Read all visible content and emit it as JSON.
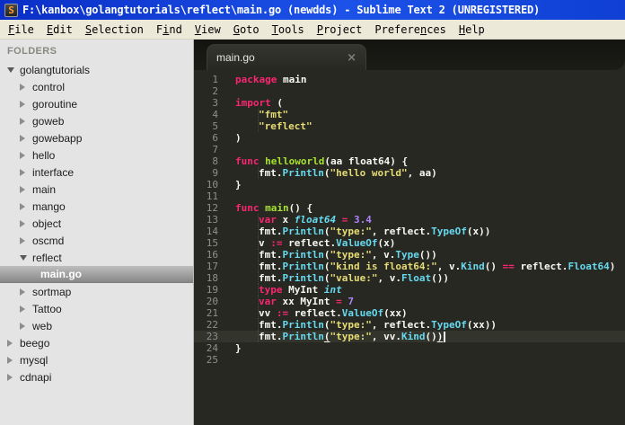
{
  "window": {
    "title": "F:\\kanbox\\golangtutorials\\reflect\\main.go (newdds) - Sublime Text 2 (UNREGISTERED)",
    "logo_letter": "S"
  },
  "menubar": {
    "items": [
      {
        "label": "File",
        "u": 0
      },
      {
        "label": "Edit",
        "u": 0
      },
      {
        "label": "Selection",
        "u": 0
      },
      {
        "label": "Find",
        "u": 1
      },
      {
        "label": "View",
        "u": 0
      },
      {
        "label": "Goto",
        "u": 0
      },
      {
        "label": "Tools",
        "u": 0
      },
      {
        "label": "Project",
        "u": 0
      },
      {
        "label": "Preferences",
        "u": 7
      },
      {
        "label": "Help",
        "u": 0
      }
    ]
  },
  "sidebar": {
    "header": "FOLDERS",
    "items": [
      {
        "label": "golangtutorials",
        "depth": 0,
        "type": "expanded"
      },
      {
        "label": "control",
        "depth": 1,
        "type": "collapsed"
      },
      {
        "label": "goroutine",
        "depth": 1,
        "type": "collapsed"
      },
      {
        "label": "goweb",
        "depth": 1,
        "type": "collapsed"
      },
      {
        "label": "gowebapp",
        "depth": 1,
        "type": "collapsed"
      },
      {
        "label": "hello",
        "depth": 1,
        "type": "collapsed"
      },
      {
        "label": "interface",
        "depth": 1,
        "type": "collapsed"
      },
      {
        "label": "main",
        "depth": 1,
        "type": "collapsed"
      },
      {
        "label": "mango",
        "depth": 1,
        "type": "collapsed"
      },
      {
        "label": "object",
        "depth": 1,
        "type": "collapsed"
      },
      {
        "label": "oscmd",
        "depth": 1,
        "type": "collapsed"
      },
      {
        "label": "reflect",
        "depth": 1,
        "type": "expanded"
      },
      {
        "label": "main.go",
        "depth": 2,
        "type": "file",
        "selected": true
      },
      {
        "label": "sortmap",
        "depth": 1,
        "type": "collapsed"
      },
      {
        "label": "Tattoo",
        "depth": 1,
        "type": "collapsed"
      },
      {
        "label": "web",
        "depth": 1,
        "type": "collapsed"
      },
      {
        "label": "beego",
        "depth": 0,
        "type": "collapsed"
      },
      {
        "label": "mysql",
        "depth": 0,
        "type": "collapsed"
      },
      {
        "label": "cdnapi",
        "depth": 0,
        "type": "collapsed"
      }
    ]
  },
  "editor": {
    "tab": {
      "label": "main.go",
      "close_glyph": "×"
    },
    "current_line": 23,
    "colors": {
      "background": "#272822",
      "keyword": "#f92672",
      "function_name": "#a6e22e",
      "string": "#e6db74",
      "type_italic": "#66d9ef",
      "call": "#66d9ef",
      "number": "#ae81ff",
      "plain": "#f8f8f2",
      "line_number": "#8f908a"
    },
    "lines": [
      [
        [
          "k",
          "package"
        ],
        [
          "p",
          " main"
        ]
      ],
      [],
      [
        [
          "k",
          "import"
        ],
        [
          "p",
          " ("
        ]
      ],
      [
        [
          "i",
          ""
        ],
        [
          "s",
          "\"fmt\""
        ]
      ],
      [
        [
          "i",
          ""
        ],
        [
          "s",
          "\"reflect\""
        ]
      ],
      [
        [
          "p",
          ")"
        ]
      ],
      [],
      [
        [
          "k",
          "func"
        ],
        [
          "f",
          " helloworld"
        ],
        [
          "p",
          "(aa float64) {"
        ]
      ],
      [
        [
          "i",
          ""
        ],
        [
          "p",
          "fmt."
        ],
        [
          "c",
          "Println"
        ],
        [
          "p",
          "("
        ],
        [
          "s",
          "\"hello world\""
        ],
        [
          "p",
          ", aa)"
        ]
      ],
      [
        [
          "p",
          "}"
        ]
      ],
      [],
      [
        [
          "k",
          "func"
        ],
        [
          "f",
          " main"
        ],
        [
          "p",
          "() {"
        ]
      ],
      [
        [
          "i",
          ""
        ],
        [
          "k",
          "var"
        ],
        [
          "p",
          " x "
        ],
        [
          "t",
          "float64"
        ],
        [
          "p",
          " "
        ],
        [
          "k",
          "="
        ],
        [
          "p",
          " "
        ],
        [
          "n",
          "3.4"
        ]
      ],
      [
        [
          "i",
          ""
        ],
        [
          "p",
          "fmt."
        ],
        [
          "c",
          "Println"
        ],
        [
          "p",
          "("
        ],
        [
          "s",
          "\"type:\""
        ],
        [
          "p",
          ", reflect."
        ],
        [
          "c",
          "TypeOf"
        ],
        [
          "p",
          "(x))"
        ]
      ],
      [
        [
          "i",
          ""
        ],
        [
          "p",
          "v "
        ],
        [
          "k",
          ":="
        ],
        [
          "p",
          " reflect."
        ],
        [
          "c",
          "ValueOf"
        ],
        [
          "p",
          "(x)"
        ]
      ],
      [
        [
          "i",
          ""
        ],
        [
          "p",
          "fmt."
        ],
        [
          "c",
          "Println"
        ],
        [
          "p",
          "("
        ],
        [
          "s",
          "\"type:\""
        ],
        [
          "p",
          ", v."
        ],
        [
          "c",
          "Type"
        ],
        [
          "p",
          "())"
        ]
      ],
      [
        [
          "i",
          ""
        ],
        [
          "p",
          "fmt."
        ],
        [
          "c",
          "Println"
        ],
        [
          "p",
          "("
        ],
        [
          "s",
          "\"kind is float64:\""
        ],
        [
          "p",
          ", v."
        ],
        [
          "c",
          "Kind"
        ],
        [
          "p",
          "() "
        ],
        [
          "k",
          "=="
        ],
        [
          "p",
          " reflect."
        ],
        [
          "c",
          "Float64"
        ],
        [
          "p",
          ")"
        ]
      ],
      [
        [
          "i",
          ""
        ],
        [
          "p",
          "fmt."
        ],
        [
          "c",
          "Println"
        ],
        [
          "p",
          "("
        ],
        [
          "s",
          "\"value:\""
        ],
        [
          "p",
          ", v."
        ],
        [
          "c",
          "Float"
        ],
        [
          "p",
          "())"
        ]
      ],
      [
        [
          "i",
          ""
        ],
        [
          "k",
          "type"
        ],
        [
          "p",
          " MyInt "
        ],
        [
          "t",
          "int"
        ]
      ],
      [
        [
          "i",
          ""
        ],
        [
          "k",
          "var"
        ],
        [
          "p",
          " xx MyInt "
        ],
        [
          "k",
          "="
        ],
        [
          "p",
          " "
        ],
        [
          "n",
          "7"
        ]
      ],
      [
        [
          "i",
          ""
        ],
        [
          "p",
          "vv "
        ],
        [
          "k",
          ":="
        ],
        [
          "p",
          " reflect."
        ],
        [
          "c",
          "ValueOf"
        ],
        [
          "p",
          "(xx)"
        ]
      ],
      [
        [
          "i",
          ""
        ],
        [
          "p",
          "fmt."
        ],
        [
          "c",
          "Println"
        ],
        [
          "p",
          "("
        ],
        [
          "s",
          "\"type:\""
        ],
        [
          "p",
          ", reflect."
        ],
        [
          "c",
          "TypeOf"
        ],
        [
          "p",
          "(xx))"
        ]
      ],
      [
        [
          "i",
          ""
        ],
        [
          "p",
          "fmt."
        ],
        [
          "c",
          "Println"
        ],
        [
          "u",
          "("
        ],
        [
          "s",
          "\"type:\""
        ],
        [
          "p",
          ", vv."
        ],
        [
          "c",
          "Kind"
        ],
        [
          "p",
          "()"
        ],
        [
          "u",
          ")"
        ],
        [
          "caret",
          ""
        ]
      ],
      [
        [
          "p",
          "}"
        ]
      ],
      []
    ]
  }
}
